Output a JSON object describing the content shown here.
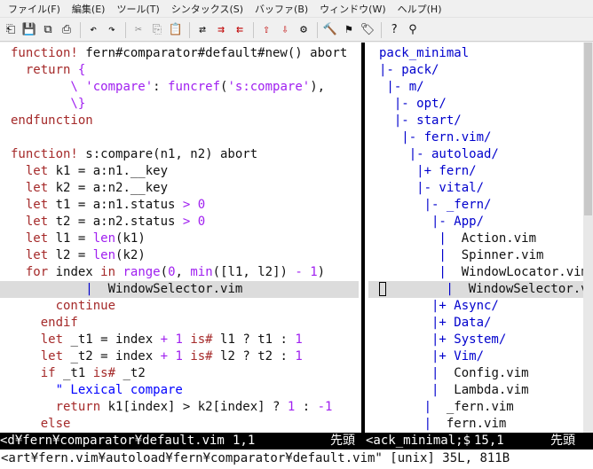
{
  "menu": [
    "ファイル(F)",
    "編集(E)",
    "ツール(T)",
    "シンタックス(S)",
    "バッファ(B)",
    "ウィンドウ(W)",
    "ヘルプ(H)"
  ],
  "toolbar": [
    {
      "name": "open-icon",
      "glyph": "⎗",
      "tone": ""
    },
    {
      "name": "save-icon",
      "glyph": "💾",
      "tone": ""
    },
    {
      "name": "save-all-icon",
      "glyph": "⧉",
      "tone": ""
    },
    {
      "name": "print-icon",
      "glyph": "⎙",
      "tone": ""
    },
    {
      "sep": true
    },
    {
      "name": "undo-icon",
      "glyph": "↶",
      "tone": ""
    },
    {
      "name": "redo-icon",
      "glyph": "↷",
      "tone": ""
    },
    {
      "sep": true
    },
    {
      "name": "cut-icon",
      "glyph": "✂",
      "tone": "gray"
    },
    {
      "name": "copy-icon",
      "glyph": "⎘",
      "tone": "gray"
    },
    {
      "name": "paste-icon",
      "glyph": "📋",
      "tone": "gray"
    },
    {
      "sep": true
    },
    {
      "name": "find-replace-icon",
      "glyph": "⇄",
      "tone": ""
    },
    {
      "name": "find-next-icon",
      "glyph": "⇉",
      "tone": "red"
    },
    {
      "name": "find-prev-icon",
      "glyph": "⇇",
      "tone": "red"
    },
    {
      "sep": true
    },
    {
      "name": "load-session-icon",
      "glyph": "⇧",
      "tone": "red"
    },
    {
      "name": "save-session-icon",
      "glyph": "⇩",
      "tone": "red"
    },
    {
      "name": "run-script-icon",
      "glyph": "⚙",
      "tone": ""
    },
    {
      "sep": true
    },
    {
      "name": "make-icon",
      "glyph": "🔨",
      "tone": ""
    },
    {
      "name": "build-tags-icon",
      "glyph": "⚑",
      "tone": ""
    },
    {
      "name": "jump-tag-icon",
      "glyph": "🏷",
      "tone": ""
    },
    {
      "sep": true
    },
    {
      "name": "help-icon",
      "glyph": "?",
      "tone": ""
    },
    {
      "name": "find-help-icon",
      "glyph": "⚲",
      "tone": ""
    }
  ],
  "left_lines": [
    {
      "cl": false,
      "tokens": [
        {
          "t": "function!",
          "k": "kw"
        },
        {
          "t": " fern#comparator#default#new() abort",
          "k": ""
        }
      ]
    },
    {
      "cl": false,
      "tokens": [
        {
          "t": "  return ",
          "k": "kw"
        },
        {
          "t": "{",
          "k": "str"
        }
      ]
    },
    {
      "cl": false,
      "tokens": [
        {
          "t": "        \\ ",
          "k": "str"
        },
        {
          "t": "'compare'",
          "k": "str"
        },
        {
          "t": ": ",
          "k": ""
        },
        {
          "t": "funcref",
          "k": "str"
        },
        {
          "t": "(",
          "k": ""
        },
        {
          "t": "'s:compare'",
          "k": "str"
        },
        {
          "t": "),",
          "k": ""
        }
      ]
    },
    {
      "cl": false,
      "tokens": [
        {
          "t": "        \\}",
          "k": "str"
        }
      ]
    },
    {
      "cl": false,
      "tokens": [
        {
          "t": "endfunction",
          "k": "kw"
        }
      ]
    },
    {
      "cl": false,
      "tokens": [
        {
          "t": "",
          "k": ""
        }
      ]
    },
    {
      "cl": false,
      "tokens": [
        {
          "t": "function!",
          "k": "kw"
        },
        {
          "t": " s:compare(n1, n2) abort",
          "k": ""
        }
      ]
    },
    {
      "cl": false,
      "tokens": [
        {
          "t": "  let",
          "k": "kw"
        },
        {
          "t": " k1 = a:n1.__key",
          "k": ""
        }
      ]
    },
    {
      "cl": false,
      "tokens": [
        {
          "t": "  let",
          "k": "kw"
        },
        {
          "t": " k2 = a:n2.__key",
          "k": ""
        }
      ]
    },
    {
      "cl": false,
      "tokens": [
        {
          "t": "  let",
          "k": "kw"
        },
        {
          "t": " t1 = a:n1.status ",
          "k": ""
        },
        {
          "t": "> 0",
          "k": "num"
        }
      ]
    },
    {
      "cl": false,
      "tokens": [
        {
          "t": "  let",
          "k": "kw"
        },
        {
          "t": " t2 = a:n2.status ",
          "k": ""
        },
        {
          "t": "> 0",
          "k": "num"
        }
      ]
    },
    {
      "cl": false,
      "tokens": [
        {
          "t": "  let",
          "k": "kw"
        },
        {
          "t": " l1 = ",
          "k": ""
        },
        {
          "t": "len",
          "k": "str"
        },
        {
          "t": "(k1)",
          "k": ""
        }
      ]
    },
    {
      "cl": false,
      "tokens": [
        {
          "t": "  let",
          "k": "kw"
        },
        {
          "t": " l2 = ",
          "k": ""
        },
        {
          "t": "len",
          "k": "str"
        },
        {
          "t": "(k2)",
          "k": ""
        }
      ]
    },
    {
      "cl": false,
      "tokens": [
        {
          "t": "  for",
          "k": "kw"
        },
        {
          "t": " index ",
          "k": ""
        },
        {
          "t": "in",
          "k": "kw"
        },
        {
          "t": " ",
          "k": ""
        },
        {
          "t": "range",
          "k": "str"
        },
        {
          "t": "(",
          "k": ""
        },
        {
          "t": "0",
          "k": "num"
        },
        {
          "t": ", ",
          "k": ""
        },
        {
          "t": "min",
          "k": "str"
        },
        {
          "t": "([l1, l2]) ",
          "k": ""
        },
        {
          "t": "- 1",
          "k": "num"
        },
        {
          "t": ")",
          "k": ""
        }
      ]
    },
    {
      "cl": true,
      "tokens": [
        {
          "t": "          ",
          "k": ""
        },
        {
          "t": "|",
          "k": "bar"
        },
        {
          "t": "  WindowSelector.vim",
          "k": ""
        }
      ]
    },
    {
      "cl": false,
      "tokens": [
        {
          "t": "      continue",
          "k": "kw"
        }
      ]
    },
    {
      "cl": false,
      "tokens": [
        {
          "t": "    endif",
          "k": "kw"
        }
      ]
    },
    {
      "cl": false,
      "tokens": [
        {
          "t": "    let",
          "k": "kw"
        },
        {
          "t": " _t1 = index ",
          "k": ""
        },
        {
          "t": "+ 1",
          "k": "num"
        },
        {
          "t": " ",
          "k": ""
        },
        {
          "t": "is#",
          "k": "kw"
        },
        {
          "t": " l1 ? t1 : ",
          "k": ""
        },
        {
          "t": "1",
          "k": "num"
        }
      ]
    },
    {
      "cl": false,
      "tokens": [
        {
          "t": "    let",
          "k": "kw"
        },
        {
          "t": " _t2 = index ",
          "k": ""
        },
        {
          "t": "+ 1",
          "k": "num"
        },
        {
          "t": " ",
          "k": ""
        },
        {
          "t": "is#",
          "k": "kw"
        },
        {
          "t": " l2 ? t2 : ",
          "k": ""
        },
        {
          "t": "1",
          "k": "num"
        }
      ]
    },
    {
      "cl": false,
      "tokens": [
        {
          "t": "    if",
          "k": "kw"
        },
        {
          "t": " _t1 ",
          "k": ""
        },
        {
          "t": "is#",
          "k": "kw"
        },
        {
          "t": " _t2",
          "k": ""
        }
      ]
    },
    {
      "cl": false,
      "tokens": [
        {
          "t": "      \" Lexical compare",
          "k": "cmt"
        }
      ]
    },
    {
      "cl": false,
      "tokens": [
        {
          "t": "      return",
          "k": "kw"
        },
        {
          "t": " k1[index] > k2[index] ? ",
          "k": ""
        },
        {
          "t": "1",
          "k": "num"
        },
        {
          "t": " : ",
          "k": ""
        },
        {
          "t": "-1",
          "k": "num"
        }
      ]
    },
    {
      "cl": false,
      "tokens": [
        {
          "t": "    else",
          "k": "kw"
        }
      ]
    }
  ],
  "right_lines": [
    {
      "cl": false,
      "cur": false,
      "tokens": [
        {
          "t": "pack_minimal",
          "k": "path"
        }
      ]
    },
    {
      "cl": false,
      "cur": false,
      "tokens": [
        {
          "t": "|- pack/",
          "k": "path"
        }
      ]
    },
    {
      "cl": false,
      "cur": false,
      "tokens": [
        {
          "t": " |- m/",
          "k": "path"
        }
      ]
    },
    {
      "cl": false,
      "cur": false,
      "tokens": [
        {
          "t": "  |- opt/",
          "k": "path"
        }
      ]
    },
    {
      "cl": false,
      "cur": false,
      "tokens": [
        {
          "t": "  |- start/",
          "k": "path"
        }
      ]
    },
    {
      "cl": false,
      "cur": false,
      "tokens": [
        {
          "t": "   |- fern.vim/",
          "k": "path"
        }
      ]
    },
    {
      "cl": false,
      "cur": false,
      "tokens": [
        {
          "t": "    |- autoload/",
          "k": "path"
        }
      ]
    },
    {
      "cl": false,
      "cur": false,
      "tokens": [
        {
          "t": "     |+ fern/",
          "k": "path"
        }
      ]
    },
    {
      "cl": false,
      "cur": false,
      "tokens": [
        {
          "t": "     |- vital/",
          "k": "path"
        }
      ]
    },
    {
      "cl": false,
      "cur": false,
      "tokens": [
        {
          "t": "      |- _fern/",
          "k": "path"
        }
      ]
    },
    {
      "cl": false,
      "cur": false,
      "tokens": [
        {
          "t": "       |- App/",
          "k": "path"
        }
      ]
    },
    {
      "cl": false,
      "cur": false,
      "tokens": [
        {
          "t": "        |",
          "k": "path"
        },
        {
          "t": "  Action.vim",
          "k": ""
        }
      ]
    },
    {
      "cl": false,
      "cur": false,
      "tokens": [
        {
          "t": "        |",
          "k": "path"
        },
        {
          "t": "  Spinner.vim",
          "k": ""
        }
      ]
    },
    {
      "cl": false,
      "cur": false,
      "tokens": [
        {
          "t": "        |",
          "k": "path"
        },
        {
          "t": "  WindowLocator.vim",
          "k": ""
        }
      ]
    },
    {
      "cl": true,
      "cur": true,
      "tokens": [
        {
          "t": "        |",
          "k": "path"
        },
        {
          "t": "  WindowSelector.vi",
          "k": ""
        }
      ]
    },
    {
      "cl": false,
      "cur": false,
      "tokens": [
        {
          "t": "       |+ Async/",
          "k": "path"
        }
      ]
    },
    {
      "cl": false,
      "cur": false,
      "tokens": [
        {
          "t": "       |+ Data/",
          "k": "path"
        }
      ]
    },
    {
      "cl": false,
      "cur": false,
      "tokens": [
        {
          "t": "       |+ System/",
          "k": "path"
        }
      ]
    },
    {
      "cl": false,
      "cur": false,
      "tokens": [
        {
          "t": "       |+ Vim/",
          "k": "path"
        }
      ]
    },
    {
      "cl": false,
      "cur": false,
      "tokens": [
        {
          "t": "       |",
          "k": "path"
        },
        {
          "t": "  Config.vim",
          "k": ""
        }
      ]
    },
    {
      "cl": false,
      "cur": false,
      "tokens": [
        {
          "t": "       |",
          "k": "path"
        },
        {
          "t": "  Lambda.vim",
          "k": ""
        }
      ]
    },
    {
      "cl": false,
      "cur": false,
      "tokens": [
        {
          "t": "      |",
          "k": "path"
        },
        {
          "t": "  _fern.vim",
          "k": ""
        }
      ]
    },
    {
      "cl": false,
      "cur": false,
      "tokens": [
        {
          "t": "      |",
          "k": "path"
        },
        {
          "t": "  fern.vim",
          "k": ""
        }
      ]
    }
  ],
  "status": {
    "left_file": "<d¥fern¥comparator¥default.vim",
    "left_pos": "1,1",
    "left_where": "先頭",
    "right_file": "<ack_minimal;$",
    "right_pos": "15,1",
    "right_where": "先頭"
  },
  "cmdline": "<art¥fern.vim¥autoload¥fern¥comparator¥default.vim\" [unix] 35L, 811B"
}
